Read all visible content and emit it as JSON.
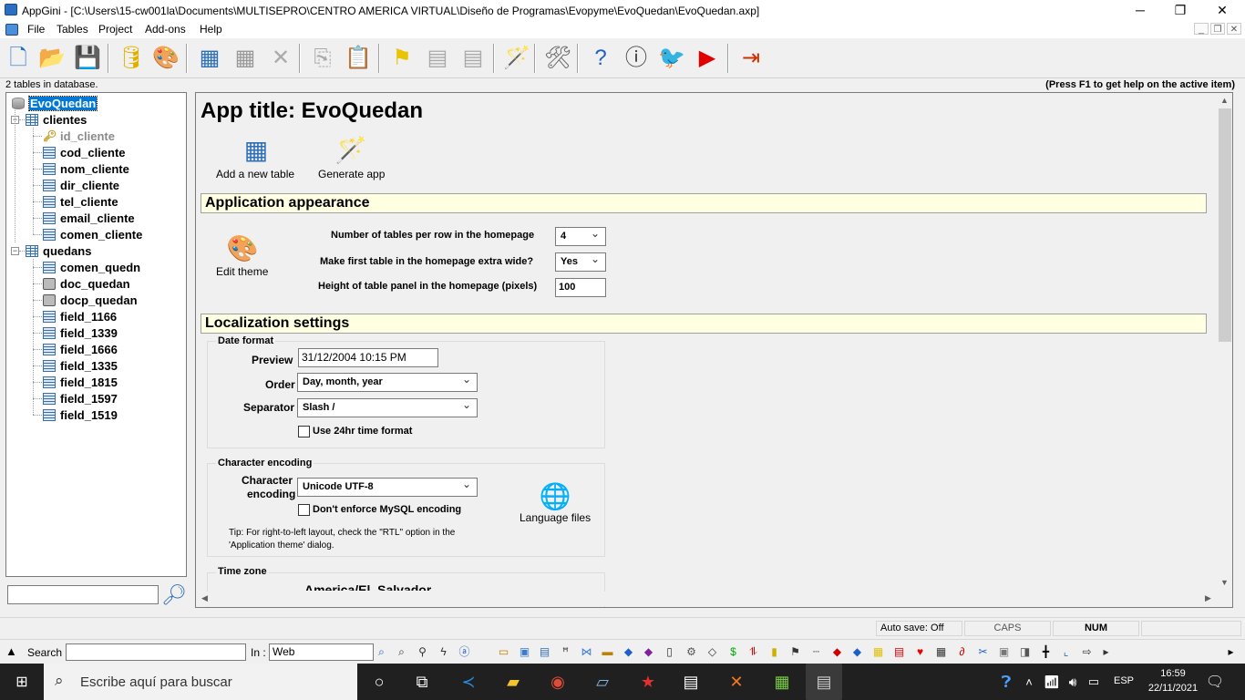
{
  "window": {
    "title": "AppGini - [C:\\Users\\15-cw001la\\Documents\\MULTISEPRO\\CENTRO AMERICA VIRTUAL\\Diseño de Programas\\Evopyme\\EvoQuedan\\EvoQuedan.axp]",
    "min": "─",
    "restore": "❐",
    "close": "✕"
  },
  "menu": [
    "File",
    "Tables",
    "Project",
    "Add-ons",
    "Help"
  ],
  "mdi": {
    "min": "_",
    "restore": "❐",
    "close": "✕"
  },
  "toolbar": [
    {
      "name": "new-project-icon",
      "glyph": "🗋",
      "color": "#1f6fc9"
    },
    {
      "name": "open-project-icon",
      "glyph": "📂",
      "color": "#3a7bd5"
    },
    {
      "name": "save-project-icon",
      "glyph": "💾",
      "color": "#8a8a8a"
    },
    {
      "name": "database-icon",
      "glyph": "🛢",
      "color": "#e0b000"
    },
    {
      "name": "theme-palette-icon",
      "glyph": "🎨",
      "color": "#d28b00"
    },
    {
      "name": "new-table-icon",
      "glyph": "▦",
      "color": "#2f6fb5"
    },
    {
      "name": "table-grid-icon",
      "glyph": "▦",
      "color": "#999"
    },
    {
      "name": "delete-icon",
      "glyph": "✕",
      "color": "#aaa"
    },
    {
      "name": "copy-icon",
      "glyph": "⎘",
      "color": "#aaa"
    },
    {
      "name": "paste-icon",
      "glyph": "📋",
      "color": "#aaa"
    },
    {
      "name": "flag-icon",
      "glyph": "⚑",
      "color": "#e8c500"
    },
    {
      "name": "move-down-icon",
      "glyph": "▤",
      "color": "#aaa"
    },
    {
      "name": "move-up-icon",
      "glyph": "▤",
      "color": "#aaa"
    },
    {
      "name": "generate-wand-icon",
      "glyph": "🪄",
      "color": "#d03000"
    },
    {
      "name": "tools-icon",
      "glyph": "🛠",
      "color": "#666"
    },
    {
      "name": "help-icon",
      "glyph": "?",
      "color": "#1f5fc9"
    },
    {
      "name": "info-icon",
      "glyph": "ⓘ",
      "color": "#333"
    },
    {
      "name": "twitter-icon",
      "glyph": "🐦",
      "color": "#1da1f2"
    },
    {
      "name": "youtube-icon",
      "glyph": "▶",
      "color": "#e00000"
    },
    {
      "name": "exit-icon",
      "glyph": "⇥",
      "color": "#d03000"
    }
  ],
  "info": {
    "left": "2 tables in database.",
    "right": "(Press F1 to get help on the active item)"
  },
  "tree": {
    "project": "EvoQuedan",
    "tables": [
      {
        "name": "clientes",
        "fields": [
          {
            "name": "id_cliente",
            "type": "key"
          },
          {
            "name": "cod_cliente",
            "type": "field"
          },
          {
            "name": "nom_cliente",
            "type": "field"
          },
          {
            "name": "dir_cliente",
            "type": "field"
          },
          {
            "name": "tel_cliente",
            "type": "field"
          },
          {
            "name": "email_cliente",
            "type": "field"
          },
          {
            "name": "comen_cliente",
            "type": "field"
          }
        ]
      },
      {
        "name": "quedans",
        "fields": [
          {
            "name": "comen_quedn",
            "type": "field"
          },
          {
            "name": "doc_quedan",
            "type": "photo"
          },
          {
            "name": "docp_quedan",
            "type": "photo"
          },
          {
            "name": "field_1166",
            "type": "field"
          },
          {
            "name": "field_1339",
            "type": "field"
          },
          {
            "name": "field_1666",
            "type": "field"
          },
          {
            "name": "field_1335",
            "type": "field"
          },
          {
            "name": "field_1815",
            "type": "field"
          },
          {
            "name": "field_1597",
            "type": "field"
          },
          {
            "name": "field_1519",
            "type": "field"
          }
        ]
      }
    ]
  },
  "main": {
    "app_title": "App title: EvoQuedan",
    "add_table": "Add a new table",
    "generate": "Generate app",
    "appearance": {
      "heading": "Application appearance",
      "edit_theme": "Edit theme",
      "tables_per_row_label": "Number of tables per row in the homepage",
      "tables_per_row": "4",
      "first_wide_label": "Make first table in the homepage extra wide?",
      "first_wide": "Yes",
      "panel_height_label": "Height of table panel in the homepage (pixels)",
      "panel_height": "100"
    },
    "localization": {
      "heading": "Localization settings",
      "date_group": "Date format",
      "preview_label": "Preview",
      "preview": "31/12/2004 10:15 PM",
      "order_label": "Order",
      "order": "Day, month, year",
      "separator_label": "Separator",
      "separator": "Slash /",
      "use24": "Use 24hr time format",
      "charset_group": "Character encoding",
      "charset_label1": "Character",
      "charset_label2": "encoding",
      "charset": "Unicode UTF-8",
      "no_enforce": "Don't enforce MySQL encoding",
      "lang_files": "Language files",
      "tip1": "Tip: For right-to-left layout, check the \"RTL\" option in the",
      "tip2": "'Application theme' dialog.",
      "tz_group": "Time zone",
      "tz_partial": "America/El_Salvador"
    }
  },
  "status": {
    "autosave": "Auto save: Off",
    "caps": "CAPS",
    "num": "NUM"
  },
  "searchbar": {
    "search_label": "Search :",
    "in_label": "In :",
    "in_value": "Web"
  },
  "taskbar": {
    "search_placeholder": "Escribe aquí para buscar",
    "lang": "ESP",
    "time": "16:59",
    "date": "22/11/2021"
  }
}
